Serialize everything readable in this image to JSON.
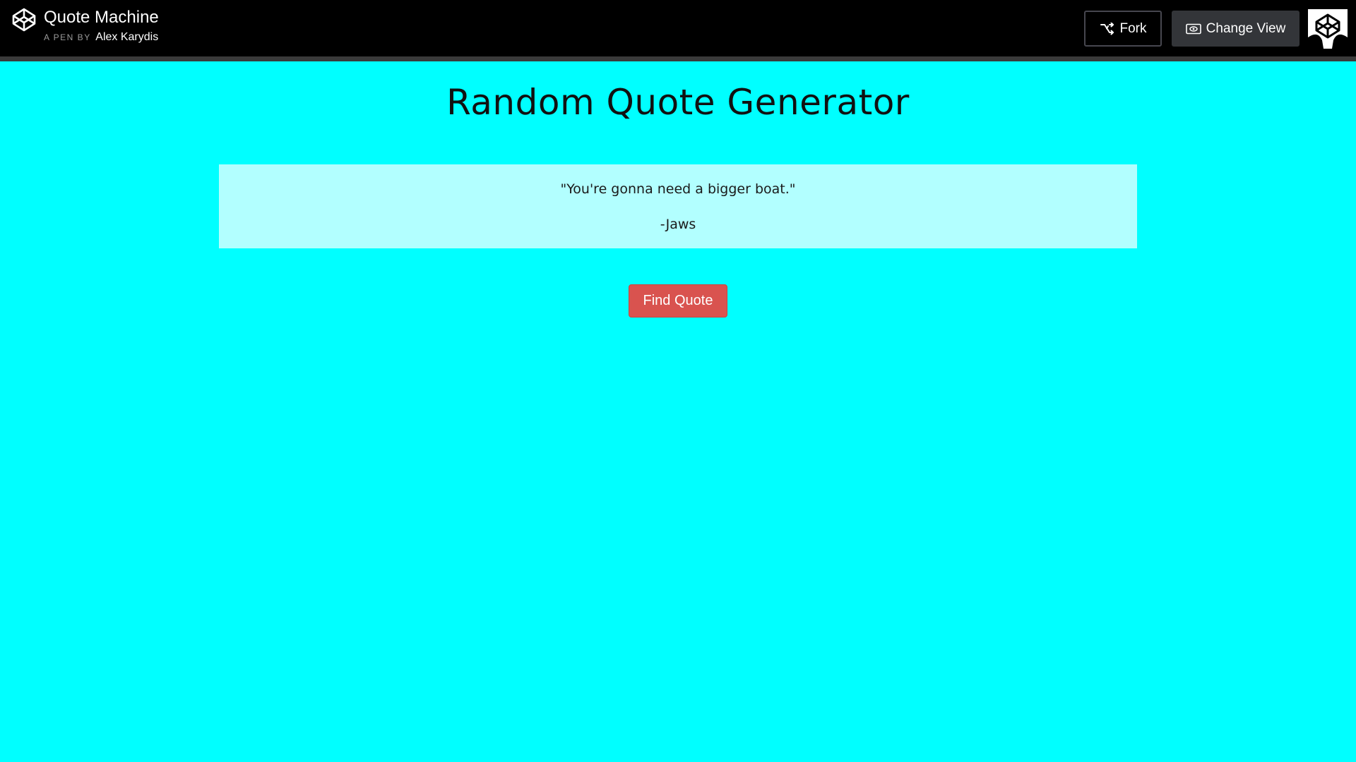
{
  "header": {
    "title": "Quote Machine",
    "byline_prefix": "A PEN BY",
    "author": "Alex Karydis",
    "fork_label": "Fork",
    "change_view_label": "Change View",
    "logo_icon": "codepen-logo-icon",
    "fork_icon": "fork-icon",
    "change_view_icon": "eye-icon"
  },
  "main": {
    "title": "Random Quote Generator",
    "quote": "\"You're gonna need a bigger boat.\"",
    "author": "-Jaws",
    "button_label": "Find Quote"
  },
  "colors": {
    "background": "#00ffff",
    "quote_box": "#b2ffff",
    "button": "#d9534f",
    "header": "#000000"
  }
}
